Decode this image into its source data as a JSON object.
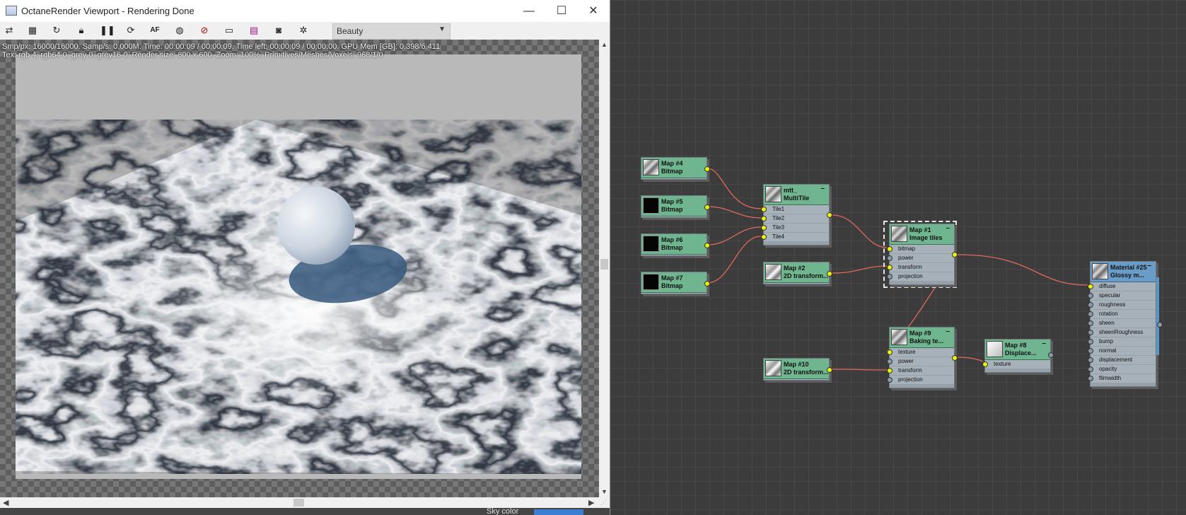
{
  "window": {
    "title": "OctaneRender Viewport - Rendering Done",
    "minimize": "—",
    "maximize": "☐",
    "close": "✕"
  },
  "toolbar": {
    "icons": [
      "send-to-viewport-icon",
      "clipboard-icon",
      "refresh-icon",
      "lock-icon",
      "pause-icon",
      "restart-icon",
      "af-icon",
      "color-icon",
      "no-entry-icon",
      "monitor-icon",
      "film-icon",
      "camera-icon",
      "settings-icon"
    ],
    "pass_select": "Beauty"
  },
  "stats": {
    "line1": "Smp/px: 16000/16000.   Samp/s: 0.000M.   Time: 00:00:09 / 00:00:09.   Time left: 00:00:09 / 00:00:00.   GPU Mem [GB]: 0.398/6.411",
    "line2": "Tex: rgb 4, rgb64 0, grey 0, grey16 0.   Render size: 800 x 600.   Zoom: 100%.   Primitives/Meshes/Voxels: 968/1/0"
  },
  "behind": {
    "sky_label": "Sky color"
  },
  "nodes": {
    "map4": {
      "title": "Map #4",
      "subtitle": "Bitmap"
    },
    "map5": {
      "title": "Map #5",
      "subtitle": "Bitmap"
    },
    "map6": {
      "title": "Map #6",
      "subtitle": "Bitmap"
    },
    "map7": {
      "title": "Map #7",
      "subtitle": "Bitmap"
    },
    "multitile": {
      "title": "mtt_",
      "subtitle": "MultiTile",
      "inputs": [
        "Tile1",
        "Tile2",
        "Tile3",
        "Tile4"
      ]
    },
    "map2": {
      "title": "Map #2",
      "subtitle": "2D transform..."
    },
    "map1": {
      "title": "Map #1",
      "subtitle": "Image tiles",
      "inputs": [
        "bitmap",
        "power",
        "transform",
        "projection"
      ]
    },
    "map9": {
      "title": "Map #9",
      "subtitle": "Baking te...",
      "inputs": [
        "texture",
        "power",
        "transform",
        "projection"
      ]
    },
    "map10": {
      "title": "Map #10",
      "subtitle": "2D transform..."
    },
    "map8": {
      "title": "Map #8",
      "subtitle": "Displace...",
      "inputs": [
        "texture"
      ]
    },
    "material25": {
      "title": "Material #25",
      "subtitle": "Glossy m...",
      "inputs": [
        "diffuse",
        "specular",
        "roughness",
        "rotation",
        "sheen",
        "sheenRoughness",
        "bump",
        "normal",
        "displacement",
        "opacity",
        "filmwidth"
      ]
    }
  },
  "colors": {
    "node_header": "#6fb58f",
    "material_header": "#6a9cc8",
    "wire": "#e0685c",
    "socket_on": "#e6f20f"
  }
}
